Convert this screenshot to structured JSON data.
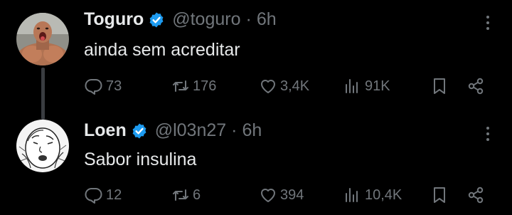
{
  "tweets": [
    {
      "name": "Toguro",
      "handle": "@toguro",
      "separator": "·",
      "time": "6h",
      "text": "ainda sem acreditar",
      "avatar": "muscular-man-photo",
      "stats": {
        "replies": "73",
        "retweets": "176",
        "likes": "3,4K",
        "views": "91K"
      }
    },
    {
      "name": "Loen",
      "handle": "@l03n27",
      "separator": "·",
      "time": "6h",
      "text": "Sabor insulina",
      "avatar": "meme-sketch-face",
      "stats": {
        "replies": "12",
        "retweets": "6",
        "likes": "394",
        "views": "10,4K"
      }
    }
  ],
  "icons": {
    "verified": "verified-badge-icon",
    "reply": "reply-icon",
    "retweet": "retweet-icon",
    "like": "heart-icon",
    "views": "views-icon",
    "bookmark": "bookmark-icon",
    "share": "share-icon",
    "more": "more-icon"
  },
  "colors": {
    "background": "#000000",
    "text": "#e7e9ea",
    "muted": "#71767b",
    "verified": "#1d9bf0",
    "thread": "#3a3d41"
  }
}
